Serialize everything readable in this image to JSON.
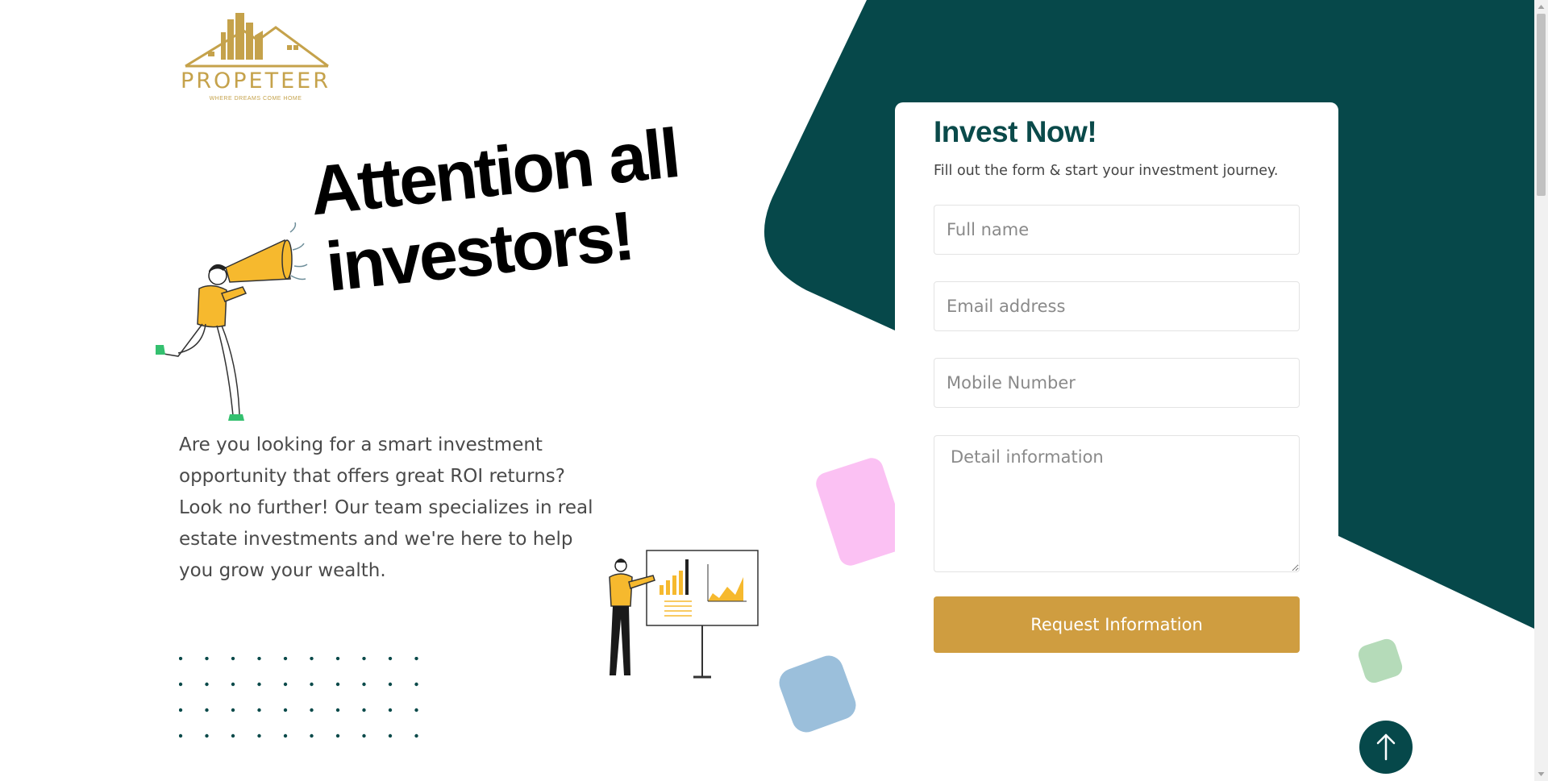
{
  "brand": {
    "name": "PROPETEER",
    "tagline": "WHERE DREAMS COME HOME"
  },
  "hero": {
    "headline_line1": "Attention all",
    "headline_line2": "investors!",
    "intro": "Are you looking for a smart investment opportunity that offers great ROI returns? Look no further! Our team specializes in real estate investments and we're here to help you grow your wealth."
  },
  "form": {
    "title": "Invest Now!",
    "subtitle": "Fill out the form & start your investment journey.",
    "full_name_placeholder": "Full name",
    "email_placeholder": "Email address",
    "mobile_placeholder": "Mobile Number",
    "details_placeholder": "Detail information",
    "submit_label": "Request Information"
  },
  "icons": {
    "scroll_top": "arrow-up-icon",
    "megaphone_person": "person-with-megaphone-illustration",
    "presenter": "presenter-with-chart-illustration"
  },
  "colors": {
    "teal": "#06484a",
    "gold": "#cf9d40",
    "logo_gold": "#c5a24b",
    "pink_tile": "#fbc1f3",
    "blue_tile": "#9bbfdb",
    "green_tile": "#b5dbb9",
    "dots": "#0a4a4a"
  }
}
